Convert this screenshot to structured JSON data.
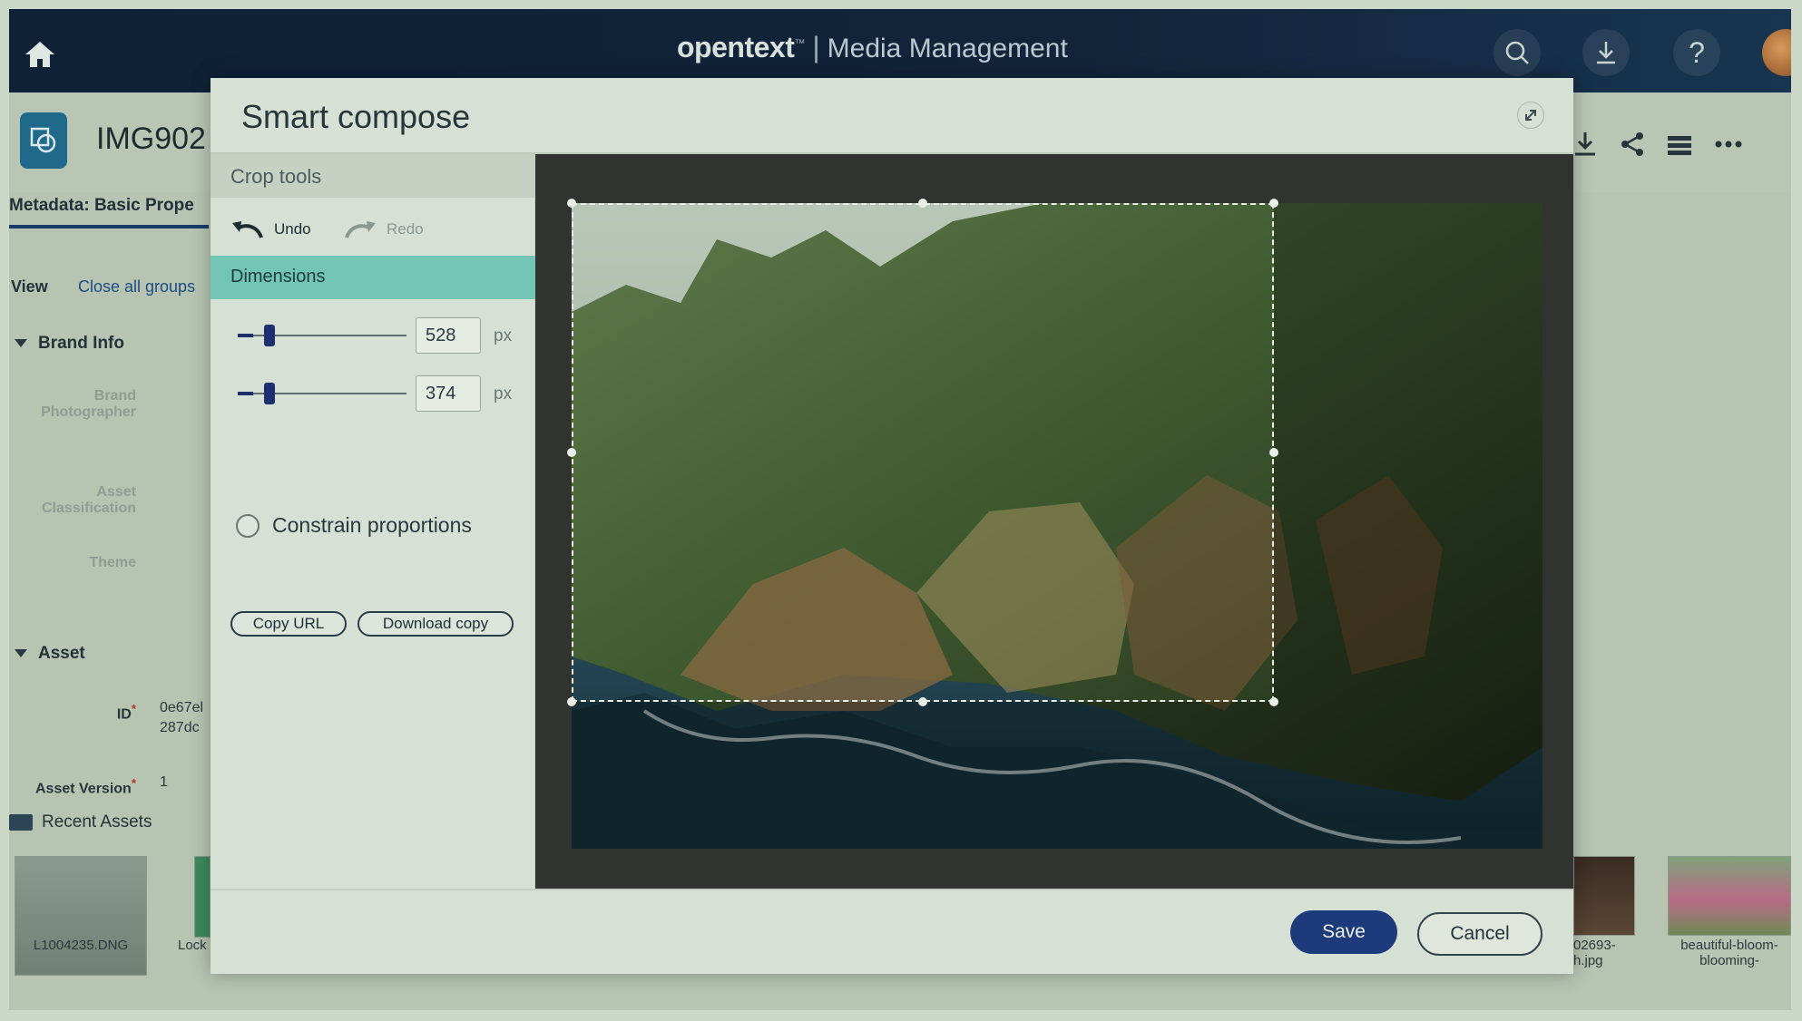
{
  "topbar": {
    "brand_name": "opentext",
    "brand_mark": "™",
    "separator": "|",
    "app_name": "Media Management",
    "icons": [
      "home-icon",
      "search-icon",
      "download-icon",
      "help-icon",
      "user-avatar"
    ]
  },
  "asset": {
    "name": "IMG902",
    "metadata_tab": "Metadata: Basic Prope",
    "view_label": "View",
    "close_groups": "Close all groups",
    "groups": {
      "brand_info": "Brand Info",
      "asset": "Asset"
    },
    "fields": {
      "brand_photographer": [
        "Brand",
        "Photographer"
      ],
      "asset_classification": [
        "Asset",
        "Classification"
      ],
      "theme": "Theme",
      "id_label": "ID",
      "id_value_1": "0e67el",
      "id_value_2": "287dc",
      "version_label": "Asset Version",
      "version_value": "1",
      "required_mark": "*"
    },
    "recent_label": "Recent Assets",
    "recent_items": {
      "first": "L1004235.DNG",
      "second": "Lock",
      "third_1": "02693-",
      "third_2": "h.jpg",
      "fourth_1": "beautiful-bloom-",
      "fourth_2": "blooming-"
    }
  },
  "modal": {
    "title": "Smart compose",
    "crop_tools": "Crop tools",
    "undo": "Undo",
    "redo": "Redo",
    "dimensions": "Dimensions",
    "width_value": "528",
    "height_value": "374",
    "unit": "px",
    "width_slider_level": 0.09,
    "height_slider_level": 0.09,
    "constrain_label": "Constrain proportions",
    "constrain_checked": false,
    "copy_url": "Copy URL",
    "download_copy": "Download copy",
    "save": "Save",
    "cancel": "Cancel"
  },
  "colors": {
    "accent_teal": "#72c4b4",
    "primary_navy": "#1d3a7a",
    "topbar": "#0f2137"
  }
}
